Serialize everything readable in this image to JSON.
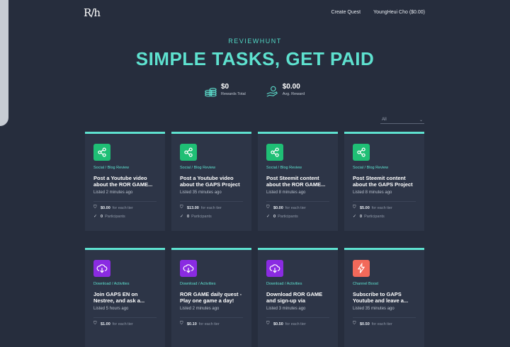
{
  "header": {
    "logo": "R/h",
    "nav": [
      "Create Quest",
      "YoungHeui Cho ($0.00)"
    ]
  },
  "hero": {
    "brand": "REVIEWHUNT",
    "title": "SIMPLE TASKS, GET PAID"
  },
  "stats": [
    {
      "value": "$0",
      "label": "Rewards Total",
      "icon": "coins-icon"
    },
    {
      "value": "$0.00",
      "label": "Avg. Reward",
      "icon": "hand-money-icon"
    }
  ],
  "filter": {
    "selected": "All"
  },
  "colors": {
    "accent": "#5ee1cf",
    "social": "#1fbf75",
    "download": "#8a2be2",
    "channel": "#f2695a"
  },
  "cards": [
    {
      "type": "social",
      "category": "Social / Blog Review",
      "title": "Post a Youtube video about the ROR GAME...",
      "listed": "Listed 2 minutes ago",
      "reward": "$0.00",
      "reward_note": "for each tier",
      "count": "0",
      "count_note": "Participants"
    },
    {
      "type": "social",
      "category": "Social / Blog Review",
      "title": "Post a Youtube video about the GAPS Project",
      "listed": "Listed 35 minutes ago",
      "reward": "$13.00",
      "reward_note": "for each tier",
      "count": "0",
      "count_note": "Participants"
    },
    {
      "type": "social",
      "category": "Social / Blog Review",
      "title": "Post Steemit content about the ROR GAME...",
      "listed": "Listed 8 minutes ago",
      "reward": "$0.00",
      "reward_note": "for each tier",
      "count": "0",
      "count_note": "Participants"
    },
    {
      "type": "social",
      "category": "Social / Blog Review",
      "title": "Post Steemit content about the GAPS Project",
      "listed": "Listed 8 minutes ago",
      "reward": "$5.00",
      "reward_note": "for each tier",
      "count": "0",
      "count_note": "Participants"
    },
    {
      "type": "download",
      "category": "Download / Activities",
      "title": "Join GAPS EN on Nestree, and ask a...",
      "listed": "Listed 5 hours ago",
      "reward": "$1.00",
      "reward_note": "for each tier",
      "count": "",
      "count_note": ""
    },
    {
      "type": "download",
      "category": "Download / Activities",
      "title": "ROR GAME daily quest - Play one game a day!",
      "listed": "Listed 2 minutes ago",
      "reward": "$0.10",
      "reward_note": "for each tier",
      "count": "",
      "count_note": ""
    },
    {
      "type": "download",
      "category": "Download / Activities",
      "title": "Download ROR GAME and sign-up via Google...",
      "listed": "Listed 3 minutes ago",
      "reward": "$0.50",
      "reward_note": "for each tier",
      "count": "",
      "count_note": ""
    },
    {
      "type": "channel",
      "category": "Channel Boost",
      "title": "Subscribe to GAPS Youtube and leave a...",
      "listed": "Listed 35 minutes ago",
      "reward": "$0.50",
      "reward_note": "for each tier",
      "count": "",
      "count_note": ""
    }
  ]
}
